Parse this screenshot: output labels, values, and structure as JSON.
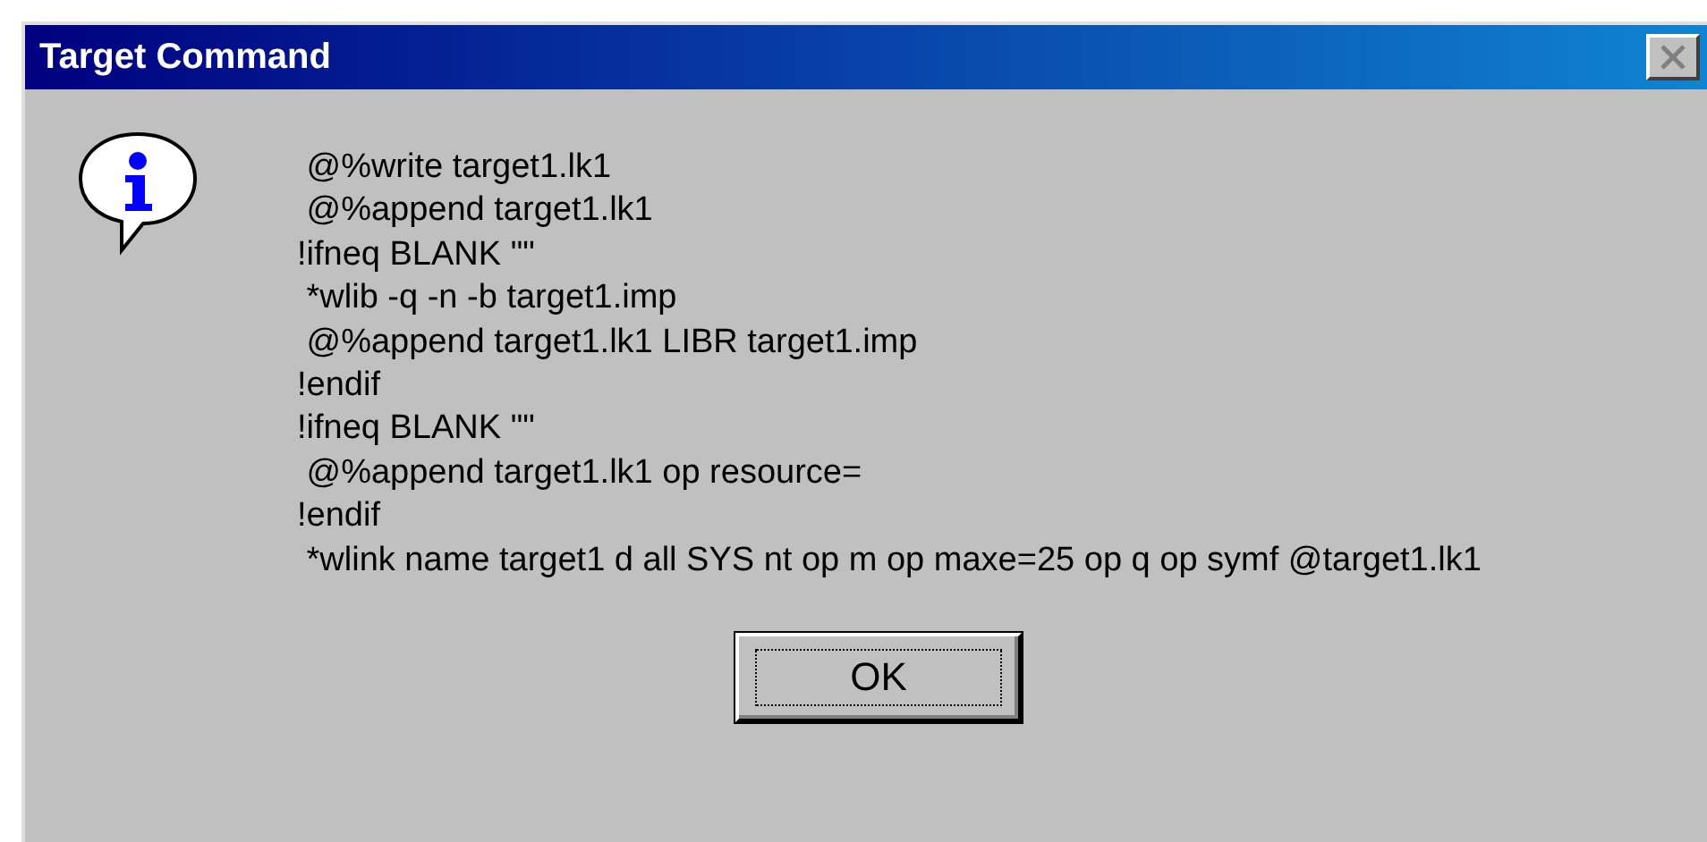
{
  "window": {
    "title": "Target Command"
  },
  "message_lines": [
    " @%write target1.lk1",
    " @%append target1.lk1",
    "!ifneq BLANK \"\"",
    " *wlib -q -n -b target1.imp",
    " @%append target1.lk1 LIBR target1.imp",
    "!endif",
    "!ifneq BLANK \"\"",
    " @%append target1.lk1 op resource=",
    "!endif",
    " *wlink name target1 d all SYS nt op m op maxe=25 op q op symf @target1.lk1"
  ],
  "buttons": [
    {
      "label": "OK",
      "focused": true
    }
  ]
}
